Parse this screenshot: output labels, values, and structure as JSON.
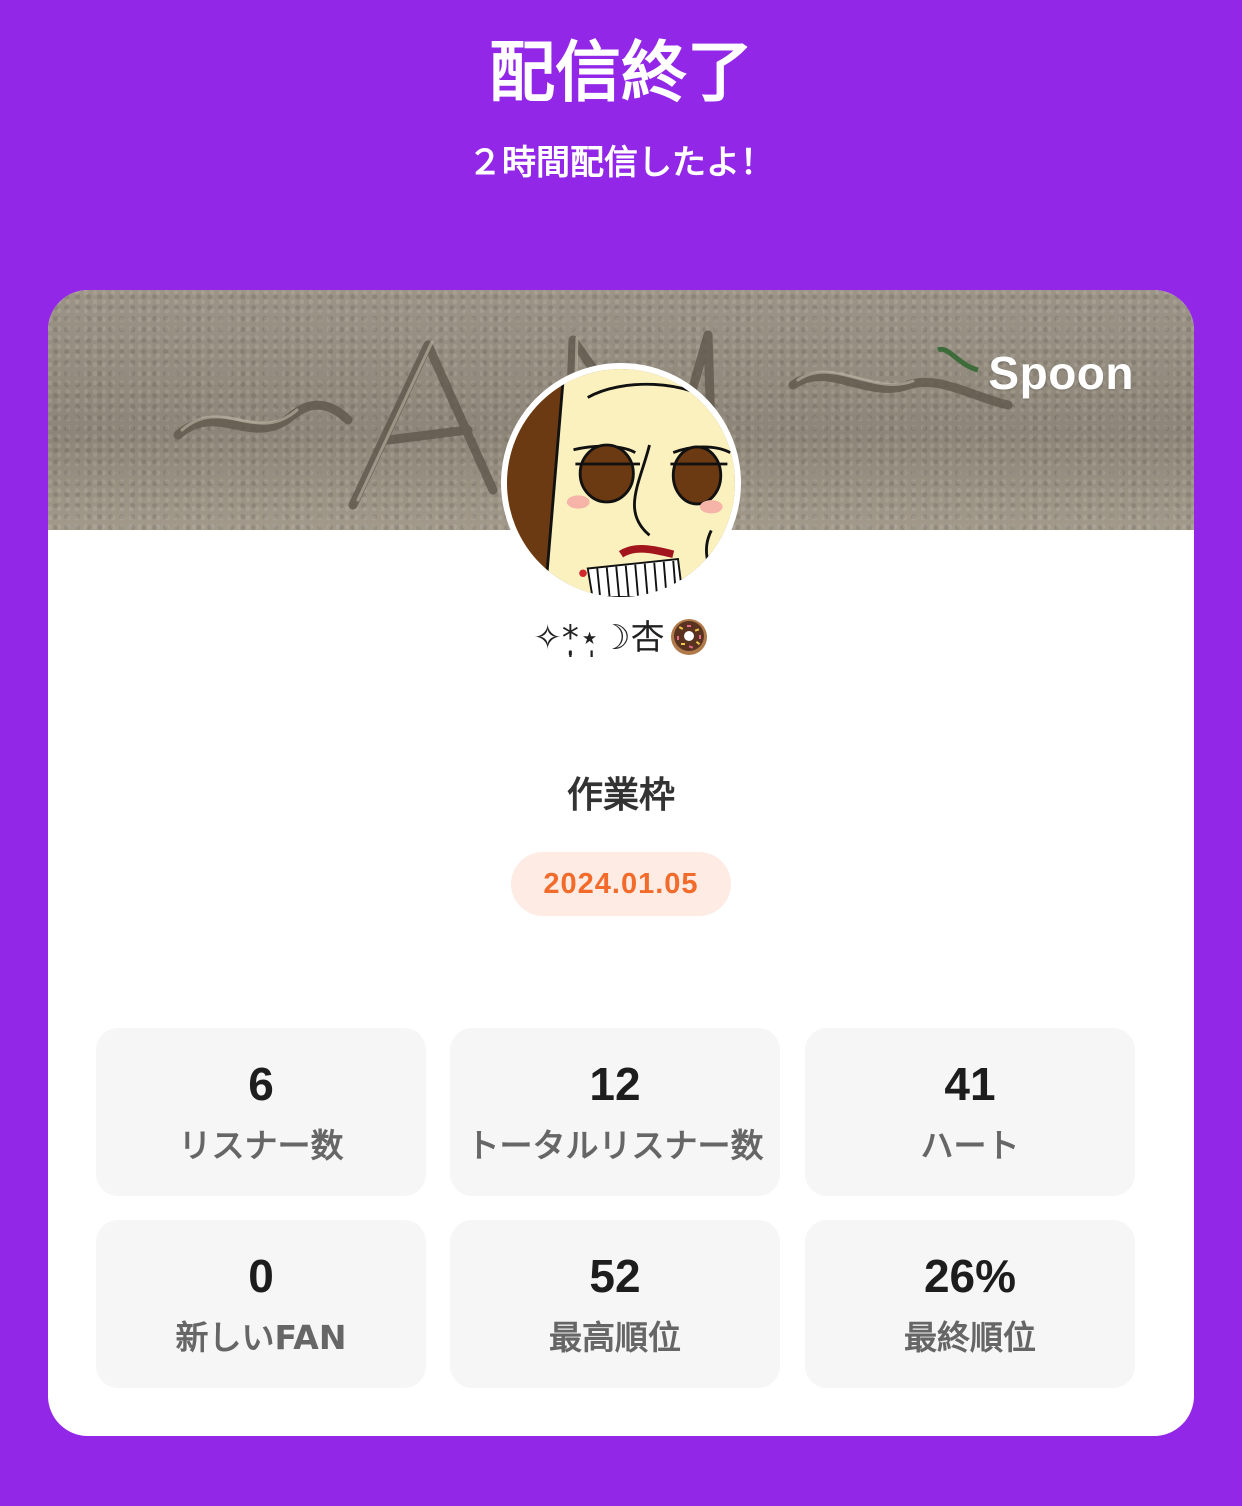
{
  "header": {
    "title": "配信終了",
    "subtitle": "２時間配信したよ！"
  },
  "card": {
    "brand": "Spoon",
    "banner_text": "~AN~",
    "username": "✧*̣̩⋆̩☽杏",
    "username_icon": "donut-icon",
    "room_title": "作業枠",
    "date": "2024.01.05",
    "stats": [
      {
        "value": "6",
        "label": "リスナー数"
      },
      {
        "value": "12",
        "label": "トータルリスナー数"
      },
      {
        "value": "41",
        "label": "ハート"
      },
      {
        "value": "0",
        "label": "新しいFAN"
      },
      {
        "value": "52",
        "label": "最高順位"
      },
      {
        "value": "26%",
        "label": "最終順位"
      }
    ]
  },
  "colors": {
    "background": "#9327e8",
    "card": "#ffffff",
    "date_text": "#f26b2a",
    "date_bg": "#fdebe4",
    "stat_bg": "#f6f6f6"
  }
}
